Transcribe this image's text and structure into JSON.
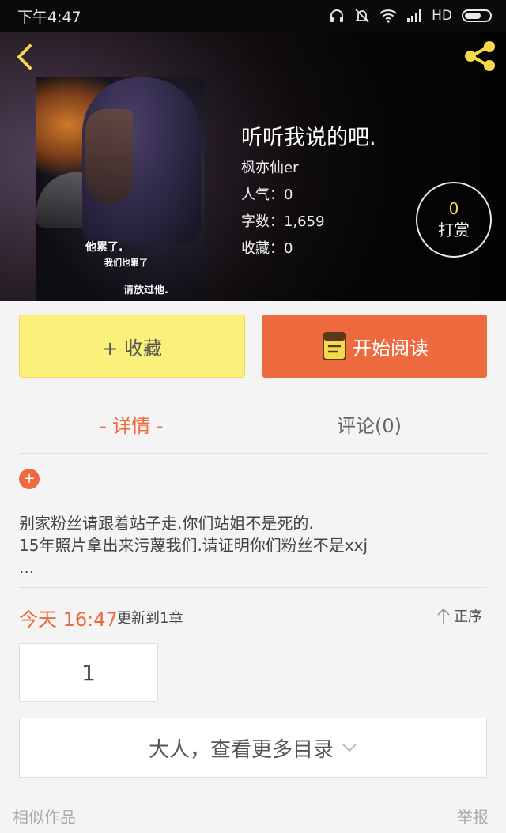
{
  "status_bar": {
    "time": "下午4:47",
    "network": "HD"
  },
  "book": {
    "title": "听听我说的吧.",
    "author": "枫亦仙er",
    "popularity": "人气：0",
    "word_count": "字数：1,659",
    "favorites": "收藏：0",
    "cover_lines": [
      "他累了.",
      "我们也累了",
      "请放过他."
    ]
  },
  "tip": {
    "count": "0",
    "label": "打赏"
  },
  "actions": {
    "favorite_label": "+ 收藏",
    "read_label": "开始阅读"
  },
  "tabs": [
    {
      "label": "- 详情 -",
      "active": true
    },
    {
      "label": "评论(0)",
      "active": false
    }
  ],
  "description": {
    "lines": [
      "别家粉丝请跟着站子走.你们站姐不是死的.",
      "15年照片拿出来污蔑我们.请证明你们粉丝不是xxj",
      "..."
    ]
  },
  "update": {
    "time": "今天 16:47",
    "info": "更新到1章",
    "sort_label": "正序"
  },
  "chapters": [
    "1"
  ],
  "more_catalog_label": "大人，查看更多目录",
  "footer": {
    "similar_label": "相似作品",
    "report_label": "举报"
  },
  "colors": {
    "accent": "#ec6a3e",
    "favorite_bg": "#faf07a",
    "tip_count": "#f5d94a"
  }
}
